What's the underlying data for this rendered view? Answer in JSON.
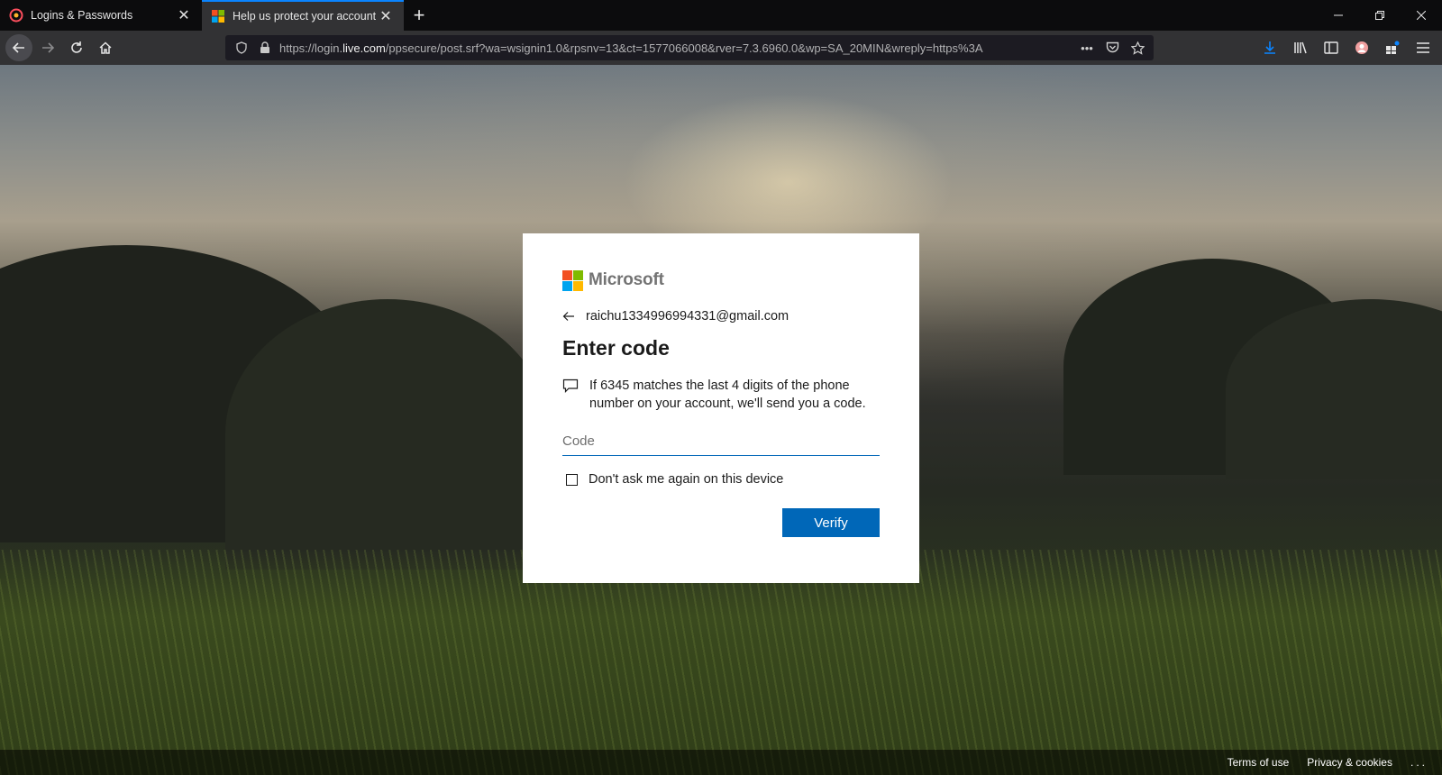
{
  "browser": {
    "tabs": [
      {
        "title": "Logins & Passwords",
        "active": false,
        "favicon": "lockwise-icon"
      },
      {
        "title": "Help us protect your account",
        "active": true,
        "favicon": "microsoft-icon"
      }
    ],
    "new_tab_icon": "plus-icon",
    "window_controls": [
      "minimize-icon",
      "restore-icon",
      "close-icon"
    ],
    "url": {
      "prefix": "https://login.",
      "domain": "live.com",
      "rest": "/ppsecure/post.srf?wa=wsignin1.0&rpsnv=13&ct=1577066008&rver=7.3.6960.0&wp=SA_20MIN&wreply=https%3A"
    },
    "accent_color": "#0a84ff"
  },
  "card": {
    "brand": "Microsoft",
    "logo_colors": [
      "#f25022",
      "#7fba00",
      "#00a4ef",
      "#ffb900"
    ],
    "email": "raichu1334996994331@gmail.com",
    "title": "Enter code",
    "message": "If 6345 matches the last 4 digits of the phone number on your account, we'll send you a code.",
    "code_placeholder": "Code",
    "code_value": "",
    "checkbox_label": "Don't ask me again on this device",
    "checkbox_checked": false,
    "verify_label": "Verify",
    "primary_color": "#0067b8"
  },
  "footer": {
    "terms": "Terms of use",
    "privacy": "Privacy & cookies",
    "more": "..."
  }
}
